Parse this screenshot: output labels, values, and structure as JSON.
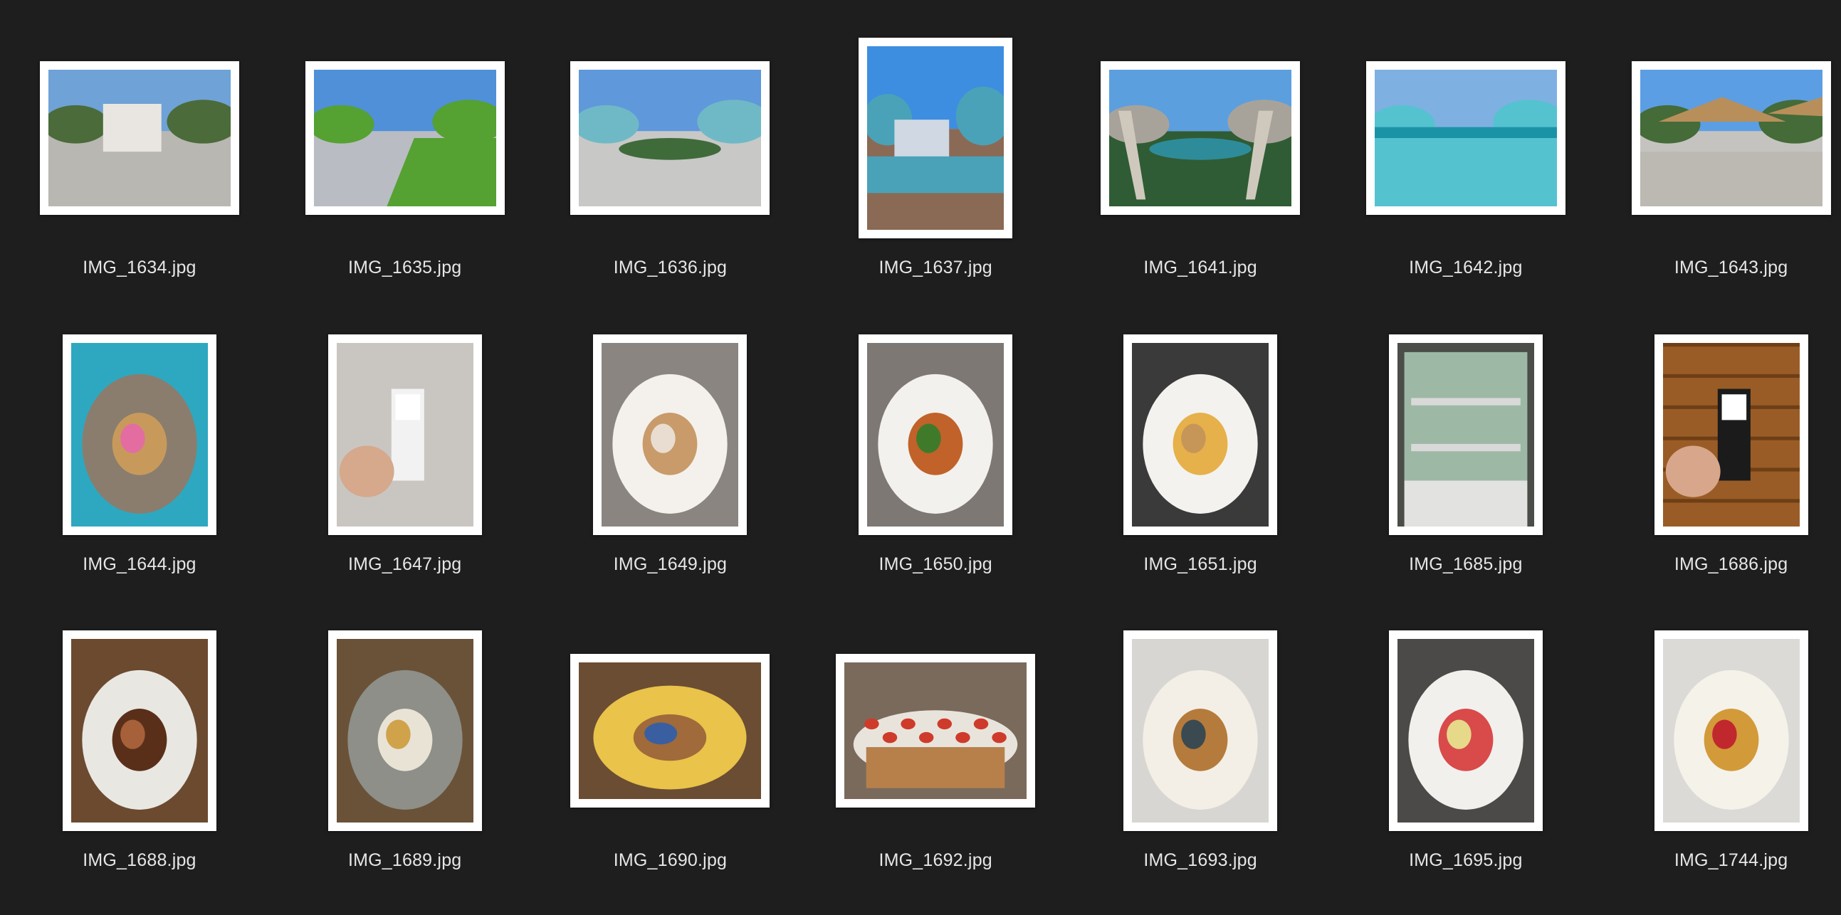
{
  "files": [
    {
      "name": "IMG_1634.jpg",
      "orientation": "landscape",
      "scene": "villa",
      "colors": [
        "#6fa2d6",
        "#e9e6e1",
        "#4b6b3a",
        "#b9b7b2"
      ]
    },
    {
      "name": "IMG_1635.jpg",
      "orientation": "landscape",
      "scene": "lawn-path",
      "colors": [
        "#4f90d8",
        "#3c7a2c",
        "#55a132",
        "#b9bcc2"
      ]
    },
    {
      "name": "IMG_1636.jpg",
      "orientation": "landscape",
      "scene": "pool-deck",
      "colors": [
        "#5f98db",
        "#3f6b3a",
        "#6fb9c6",
        "#c8c8c6"
      ]
    },
    {
      "name": "IMG_1637.jpg",
      "orientation": "portrait",
      "scene": "waterslide",
      "colors": [
        "#3d8ee0",
        "#cfd8e3",
        "#4aa2b8",
        "#8a6a55"
      ]
    },
    {
      "name": "IMG_1641.jpg",
      "orientation": "landscape",
      "scene": "pool-umbrellas",
      "colors": [
        "#5c9fdf",
        "#2e8c9a",
        "#a8a39a",
        "#2f5c34"
      ]
    },
    {
      "name": "IMG_1642.jpg",
      "orientation": "landscape",
      "scene": "pool",
      "colors": [
        "#7fb0e2",
        "#1b93a6",
        "#55c2cf",
        "#7b8a6d"
      ]
    },
    {
      "name": "IMG_1643.jpg",
      "orientation": "landscape",
      "scene": "terrace",
      "colors": [
        "#5c9ee3",
        "#b88f5a",
        "#446b38",
        "#c5c3bf"
      ]
    },
    {
      "name": "IMG_1644.jpg",
      "orientation": "portrait",
      "scene": "poolside-table",
      "colors": [
        "#2ea8c0",
        "#8a7d6e",
        "#c79a5c",
        "#e36da0"
      ]
    },
    {
      "name": "IMG_1647.jpg",
      "orientation": "portrait",
      "scene": "qr-stand",
      "colors": [
        "#c9c6c2",
        "#1a1a1a",
        "#d6a88c",
        "#f2f2f2"
      ]
    },
    {
      "name": "IMG_1649.jpg",
      "orientation": "portrait",
      "scene": "plate-wrap",
      "colors": [
        "#8a8580",
        "#f4f1ec",
        "#c99b6a",
        "#e8ddd0"
      ]
    },
    {
      "name": "IMG_1650.jpg",
      "orientation": "portrait",
      "scene": "plate-chicken",
      "colors": [
        "#7d7873",
        "#f3f1ed",
        "#c0622a",
        "#3f7a2a"
      ]
    },
    {
      "name": "IMG_1651.jpg",
      "orientation": "portrait",
      "scene": "plate-fries",
      "colors": [
        "#3a3a3a",
        "#f4f2ee",
        "#e6b04a",
        "#c69658"
      ]
    },
    {
      "name": "IMG_1685.jpg",
      "orientation": "portrait",
      "scene": "display-case",
      "colors": [
        "#4a4d48",
        "#9eb8a6",
        "#e2e2e0",
        "#d9d9d9"
      ]
    },
    {
      "name": "IMG_1686.jpg",
      "orientation": "portrait",
      "scene": "wood-table-qr",
      "colors": [
        "#9a5c26",
        "#6e3f16",
        "#d7a68b",
        "#1b1b1b"
      ]
    },
    {
      "name": "IMG_1688.jpg",
      "orientation": "portrait",
      "scene": "plate-stew",
      "colors": [
        "#6b4a30",
        "#e9e7e2",
        "#5a2f1a",
        "#a6603a"
      ]
    },
    {
      "name": "IMG_1689.jpg",
      "orientation": "portrait",
      "scene": "plate-dumplings",
      "colors": [
        "#6a5238",
        "#8d8f88",
        "#e9e3d6",
        "#d0a24a"
      ]
    },
    {
      "name": "IMG_1690.jpg",
      "orientation": "landscape",
      "scene": "burger-fries",
      "colors": [
        "#6b4d33",
        "#e9c34a",
        "#a06a3a",
        "#3a5fa0"
      ]
    },
    {
      "name": "IMG_1692.jpg",
      "orientation": "landscape",
      "scene": "buffet",
      "colors": [
        "#7a6a5c",
        "#e8e4dc",
        "#b7804a",
        "#cf3b2a"
      ]
    },
    {
      "name": "IMG_1693.jpg",
      "orientation": "portrait",
      "scene": "dessert-plate",
      "colors": [
        "#d8d6d2",
        "#f3efe6",
        "#b57b3c",
        "#3a4a50"
      ]
    },
    {
      "name": "IMG_1695.jpg",
      "orientation": "portrait",
      "scene": "fruit-plate",
      "colors": [
        "#4b4a48",
        "#f2f0ec",
        "#d94a4a",
        "#e6d98a"
      ]
    },
    {
      "name": "IMG_1744.jpg",
      "orientation": "portrait",
      "scene": "cake-plate",
      "colors": [
        "#dcdad6",
        "#f5f2ea",
        "#d39a3a",
        "#c0282e"
      ]
    }
  ]
}
